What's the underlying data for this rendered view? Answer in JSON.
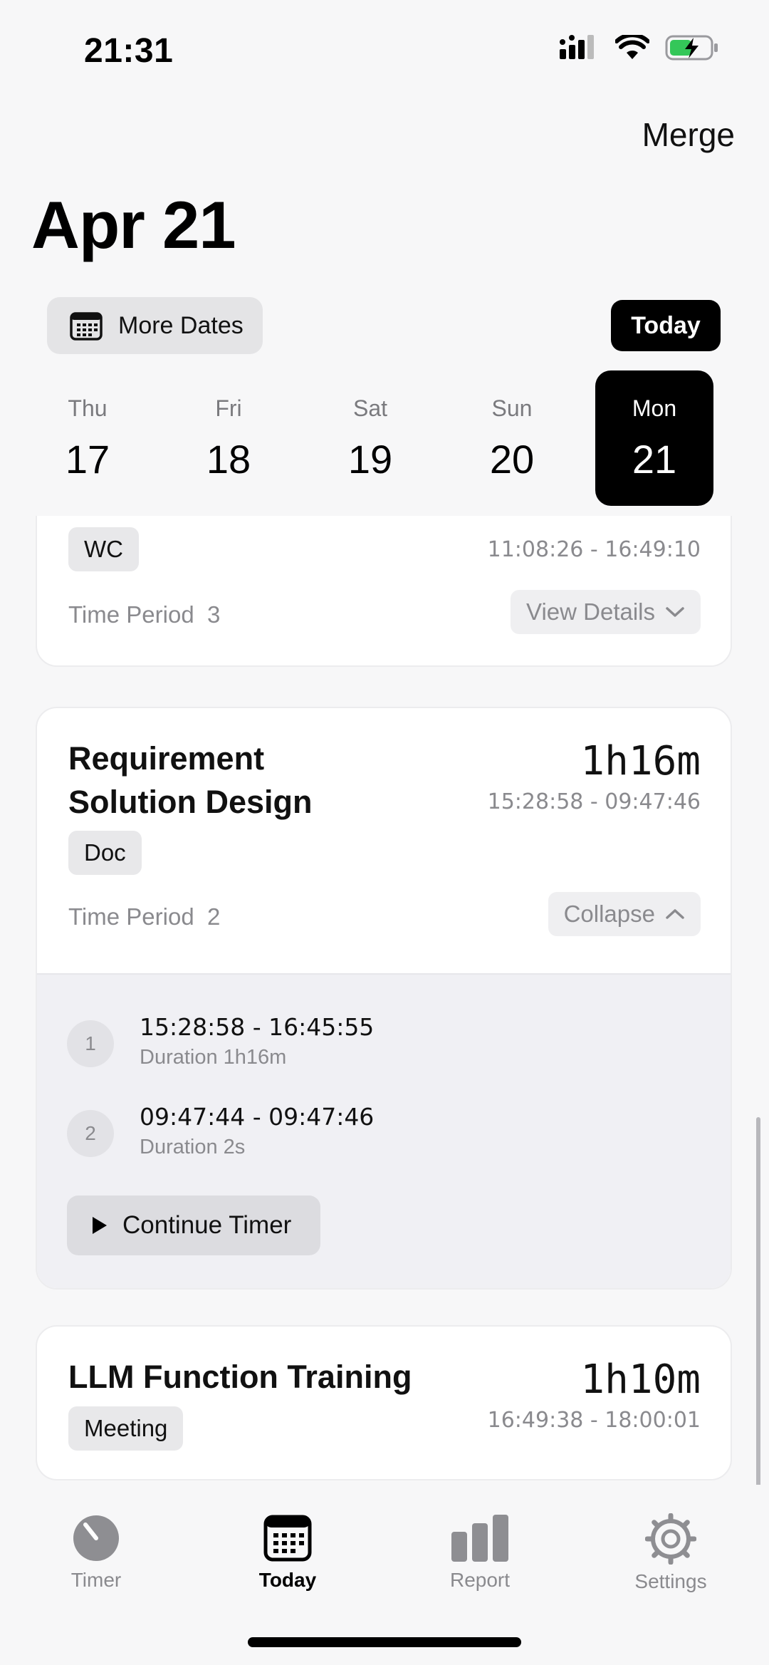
{
  "status_bar": {
    "time": "21:31"
  },
  "header": {
    "merge_label": "Merge",
    "title": "Apr 21"
  },
  "date_controls": {
    "more_dates_label": "More Dates",
    "today_label": "Today"
  },
  "week": [
    {
      "dow": "Thu",
      "day": "17"
    },
    {
      "dow": "Fri",
      "day": "18"
    },
    {
      "dow": "Sat",
      "day": "19"
    },
    {
      "dow": "Sun",
      "day": "20"
    },
    {
      "dow": "Mon",
      "day": "21",
      "selected": true
    }
  ],
  "entries": [
    {
      "tag": "WC",
      "range": "11:08:26 - 16:49:10",
      "period_label": "Time Period",
      "period_count": "3",
      "action_label": "View Details"
    },
    {
      "title_line1": "Requirement",
      "title_line2": "Solution Design",
      "total": "1h16m",
      "range": "15:28:58 - 09:47:46",
      "tag": "Doc",
      "period_label": "Time Period",
      "period_count": "2",
      "action_label": "Collapse",
      "periods": [
        {
          "index": "1",
          "range": "15:28:58 - 16:45:55",
          "duration": "Duration 1h16m"
        },
        {
          "index": "2",
          "range": "09:47:44 - 09:47:46",
          "duration": "Duration 2s"
        }
      ],
      "continue_label": "Continue Timer"
    },
    {
      "title": "LLM Function Training",
      "total": "1h10m",
      "range": "16:49:38 - 18:00:01",
      "tag": "Meeting"
    }
  ],
  "tabs": [
    {
      "label": "Timer",
      "icon": "stopwatch-icon"
    },
    {
      "label": "Today",
      "icon": "calendar-icon",
      "active": true
    },
    {
      "label": "Report",
      "icon": "bar-chart-icon"
    },
    {
      "label": "Settings",
      "icon": "gear-icon"
    }
  ],
  "colors": {
    "accent": "#000000",
    "muted": "#8a8a8e",
    "battery_green": "#34c759"
  }
}
